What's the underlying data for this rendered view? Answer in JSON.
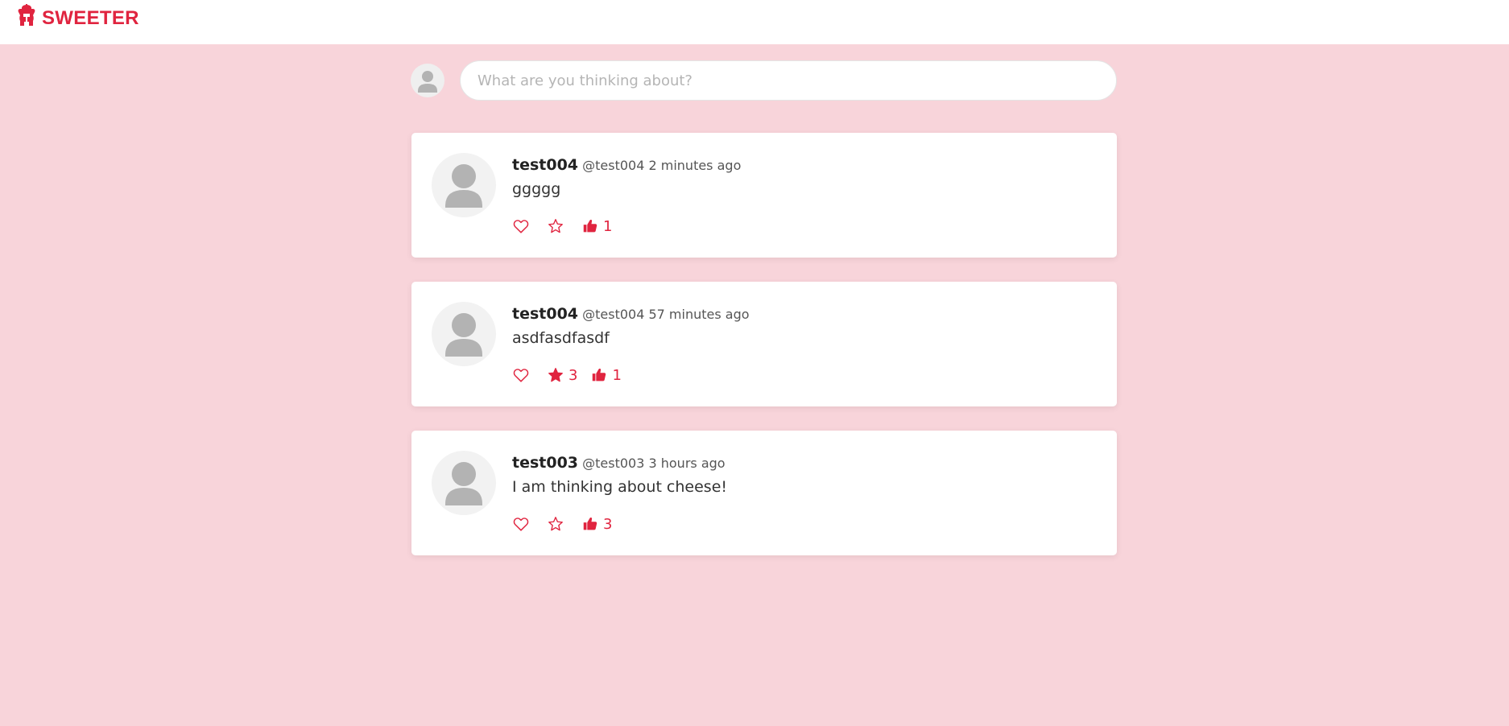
{
  "app": {
    "name": "SWEETER",
    "accent_color": "#e0243f",
    "background_color": "#f8d4da"
  },
  "header": {
    "logo_icon": "spartan-helmet-icon"
  },
  "composer": {
    "placeholder": "What are you thinking about?",
    "value": ""
  },
  "posts": [
    {
      "username": "test004",
      "handle": "@test004",
      "time": "2 minutes ago",
      "content": "ggggg",
      "likes": {
        "active": false,
        "count": ""
      },
      "favorites": {
        "active": false,
        "count": ""
      },
      "thumbs": {
        "active": true,
        "count": "1"
      }
    },
    {
      "username": "test004",
      "handle": "@test004",
      "time": "57 minutes ago",
      "content": "asdfasdfasdf",
      "likes": {
        "active": false,
        "count": ""
      },
      "favorites": {
        "active": true,
        "count": "3"
      },
      "thumbs": {
        "active": true,
        "count": "1"
      }
    },
    {
      "username": "test003",
      "handle": "@test003",
      "time": "3 hours ago",
      "content": "I am thinking about cheese!",
      "likes": {
        "active": false,
        "count": ""
      },
      "favorites": {
        "active": false,
        "count": ""
      },
      "thumbs": {
        "active": true,
        "count": "3"
      }
    }
  ]
}
